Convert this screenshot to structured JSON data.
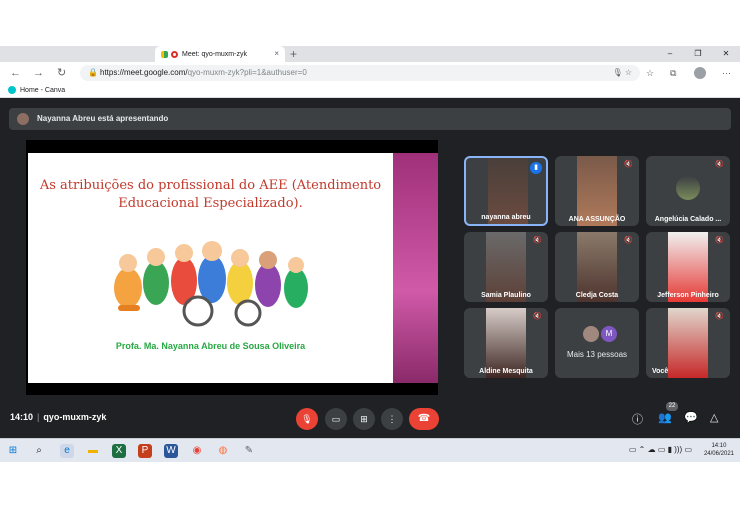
{
  "browser": {
    "tab_title": "Meet: qyo-muxm-zyk",
    "tab_close": "×",
    "new_tab": "+",
    "window_controls": [
      "–",
      "❐",
      "✕"
    ],
    "url_main": "https://meet.google.com/",
    "url_rest": "qyo-muxm-zyk?pli=1&authuser=0",
    "nav": {
      "back": "←",
      "forward": "→",
      "reload": "↻"
    },
    "bookmark_label": "Home - Canva"
  },
  "banner": {
    "text": "Nayanna Abreu está apresentando"
  },
  "slide": {
    "title_line1": "As atribuições do profissional do AEE (Atendimento",
    "title_line2": "Educacional Especializado).",
    "author": "Profa. Ma. Nayanna Abreu de Sousa Oliveira"
  },
  "participants": [
    {
      "name": "nayanna abreu",
      "photo_color": "#6d4c41",
      "bg": "#4a3f3a"
    },
    {
      "name": "ANA ASSUNÇÃO",
      "photo_color": "#b07a5a",
      "bg": "#7a5a4a"
    },
    {
      "name": "Angelúcia Calado ...",
      "photo_color": "#7a8c5a",
      "bg": "#3c4043"
    },
    {
      "name": "Samia Plaulino",
      "photo_color": "#5d4037",
      "bg": "#6a6a6a"
    },
    {
      "name": "Cledja Costa",
      "photo_color": "#4e342e",
      "bg": "#8a7a6a"
    },
    {
      "name": "Jefferson Pinheiro",
      "photo_color": "#e53935",
      "bg": "#f0f0f0"
    },
    {
      "name": "Aldine Mesquita",
      "photo_color": "#3e2723",
      "bg": "#d7ccc8"
    },
    {
      "name": "Mais 13 pessoas",
      "avatar_letter": "M"
    },
    {
      "name": "Você",
      "photo_color": "#c62828",
      "bg": "#e0d6cc"
    }
  ],
  "bottom": {
    "time": "14:10",
    "meeting_code": "qyo-muxm-zyk",
    "people_count": "22",
    "separator": "|"
  },
  "taskbar": {
    "clock_time": "14:10",
    "clock_date": "24/06/2021"
  }
}
